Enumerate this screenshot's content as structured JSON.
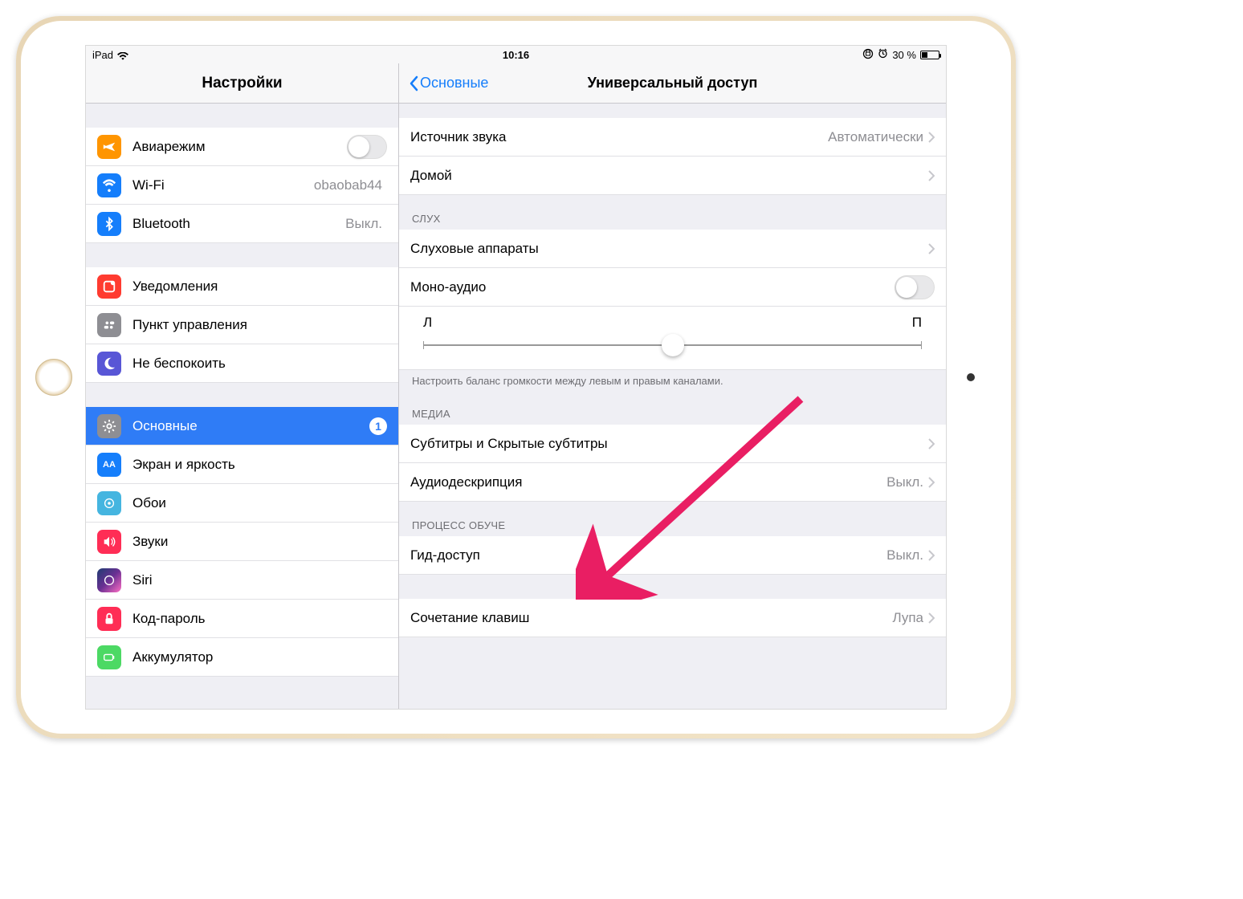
{
  "status": {
    "device": "iPad",
    "time": "10:16",
    "battery_text": "30 %"
  },
  "sidebar": {
    "title": "Настройки",
    "items": [
      {
        "label": "Авиарежим",
        "value": "",
        "has_switch": true
      },
      {
        "label": "Wi-Fi",
        "value": "obaobab44"
      },
      {
        "label": "Bluetooth",
        "value": "Выкл."
      },
      {
        "label": "Уведомления",
        "value": ""
      },
      {
        "label": "Пункт управления",
        "value": ""
      },
      {
        "label": "Не беспокоить",
        "value": ""
      },
      {
        "label": "Основные",
        "value": "",
        "selected": true,
        "badge": "1"
      },
      {
        "label": "Экран и яркость",
        "value": ""
      },
      {
        "label": "Обои",
        "value": ""
      },
      {
        "label": "Звуки",
        "value": ""
      },
      {
        "label": "Siri",
        "value": ""
      },
      {
        "label": "Код-пароль",
        "value": ""
      },
      {
        "label": "Аккумулятор",
        "value": ""
      }
    ]
  },
  "detail": {
    "back_label": "Основные",
    "title": "Универсальный доступ",
    "top_rows": [
      {
        "label": "Источник звука",
        "value": "Автоматически"
      },
      {
        "label": "Домой",
        "value": ""
      }
    ],
    "hearing_header": "СЛУХ",
    "hearing_rows": [
      {
        "label": "Слуховые аппараты",
        "value": ""
      },
      {
        "label": "Моно-аудио",
        "value": "",
        "has_switch": true
      }
    ],
    "balance": {
      "left": "Л",
      "right": "П"
    },
    "balance_footer": "Настроить баланс громкости между левым и правым каналами.",
    "media_header": "МЕДИА",
    "media_rows": [
      {
        "label": "Субтитры и Скрытые субтитры",
        "value": ""
      },
      {
        "label": "Аудиодескрипция",
        "value": "Выкл."
      }
    ],
    "learning_header": "ПРОЦЕСС ОБУЧЕ",
    "learning_rows": [
      {
        "label": "Гид-доступ",
        "value": "Выкл."
      }
    ],
    "shortcut_rows": [
      {
        "label": "Сочетание клавиш",
        "value": "Лупа"
      }
    ]
  },
  "annotation": {
    "color": "#e91e63",
    "kind": "arrow"
  }
}
